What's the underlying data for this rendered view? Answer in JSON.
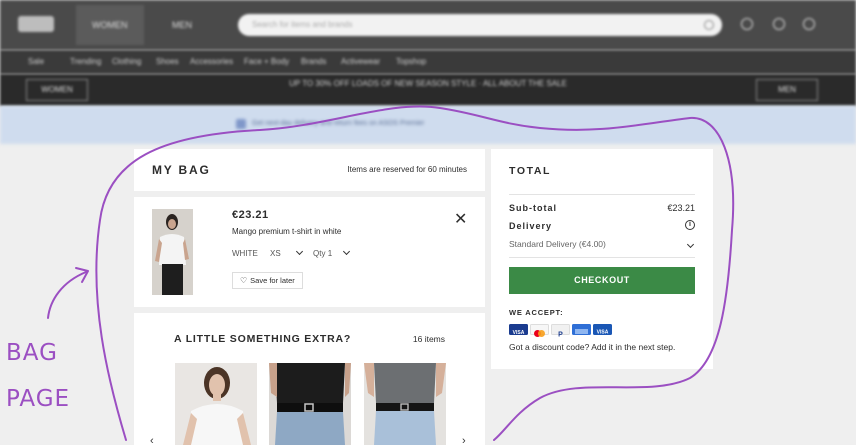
{
  "header": {
    "women_tab": "WOMEN",
    "men_tab": "MEN",
    "search_placeholder": "Search for items and brands",
    "categories": [
      "Sale",
      "Trending",
      "Clothing",
      "Shoes",
      "Accessories",
      "Face + Body",
      "Brands",
      "Activewear",
      "Topshop"
    ]
  },
  "promo": {
    "left_button": "WOMEN",
    "right_button": "MEN",
    "text": "UP TO 30% OFF LOADS OF NEW SEASON STYLE · ALL ABOUT THE SALE"
  },
  "info_bar": {
    "text": "Get next-day delivery and return fees on ASOS Premier"
  },
  "bag": {
    "title": "MY BAG",
    "reserved": "Items are reserved for 60 minutes",
    "item": {
      "price": "€23.21",
      "name": "Mango premium t-shirt in white",
      "color": "WHITE",
      "size": "XS",
      "qty_label": "Qty",
      "qty": "1",
      "save_label": "Save for later",
      "close_glyph": "✕"
    }
  },
  "extra": {
    "title": "A LITTLE SOMETHING EXTRA?",
    "count": "16 items"
  },
  "total": {
    "title": "TOTAL",
    "subtotal_label": "Sub-total",
    "subtotal_value": "€23.21",
    "delivery_label": "Delivery",
    "delivery_option": "Standard Delivery (€4.00)",
    "checkout": "CHECKOUT",
    "accept": "WE ACCEPT:",
    "discount": "Got a discount code? Add it in the next step.",
    "cards": [
      {
        "name": "visa",
        "color": "#1a3b8f",
        "label": "VISA"
      },
      {
        "name": "mastercard",
        "color": "#f7f7f7",
        "label": ""
      },
      {
        "name": "paypal",
        "color": "#f1f1f1",
        "label": "P"
      },
      {
        "name": "amex",
        "color": "#2f6fd6",
        "label": ""
      },
      {
        "name": "visa-electron",
        "color": "#1a57b5",
        "label": "VISA"
      }
    ]
  },
  "annotation": {
    "line1": "BAG",
    "line2": "PAGE",
    "stroke_color": "#9b4fc2"
  },
  "colors": {
    "checkout_green": "#3b8a46",
    "header_dark": "#4a4a4a",
    "page_bg": "#efefef"
  }
}
